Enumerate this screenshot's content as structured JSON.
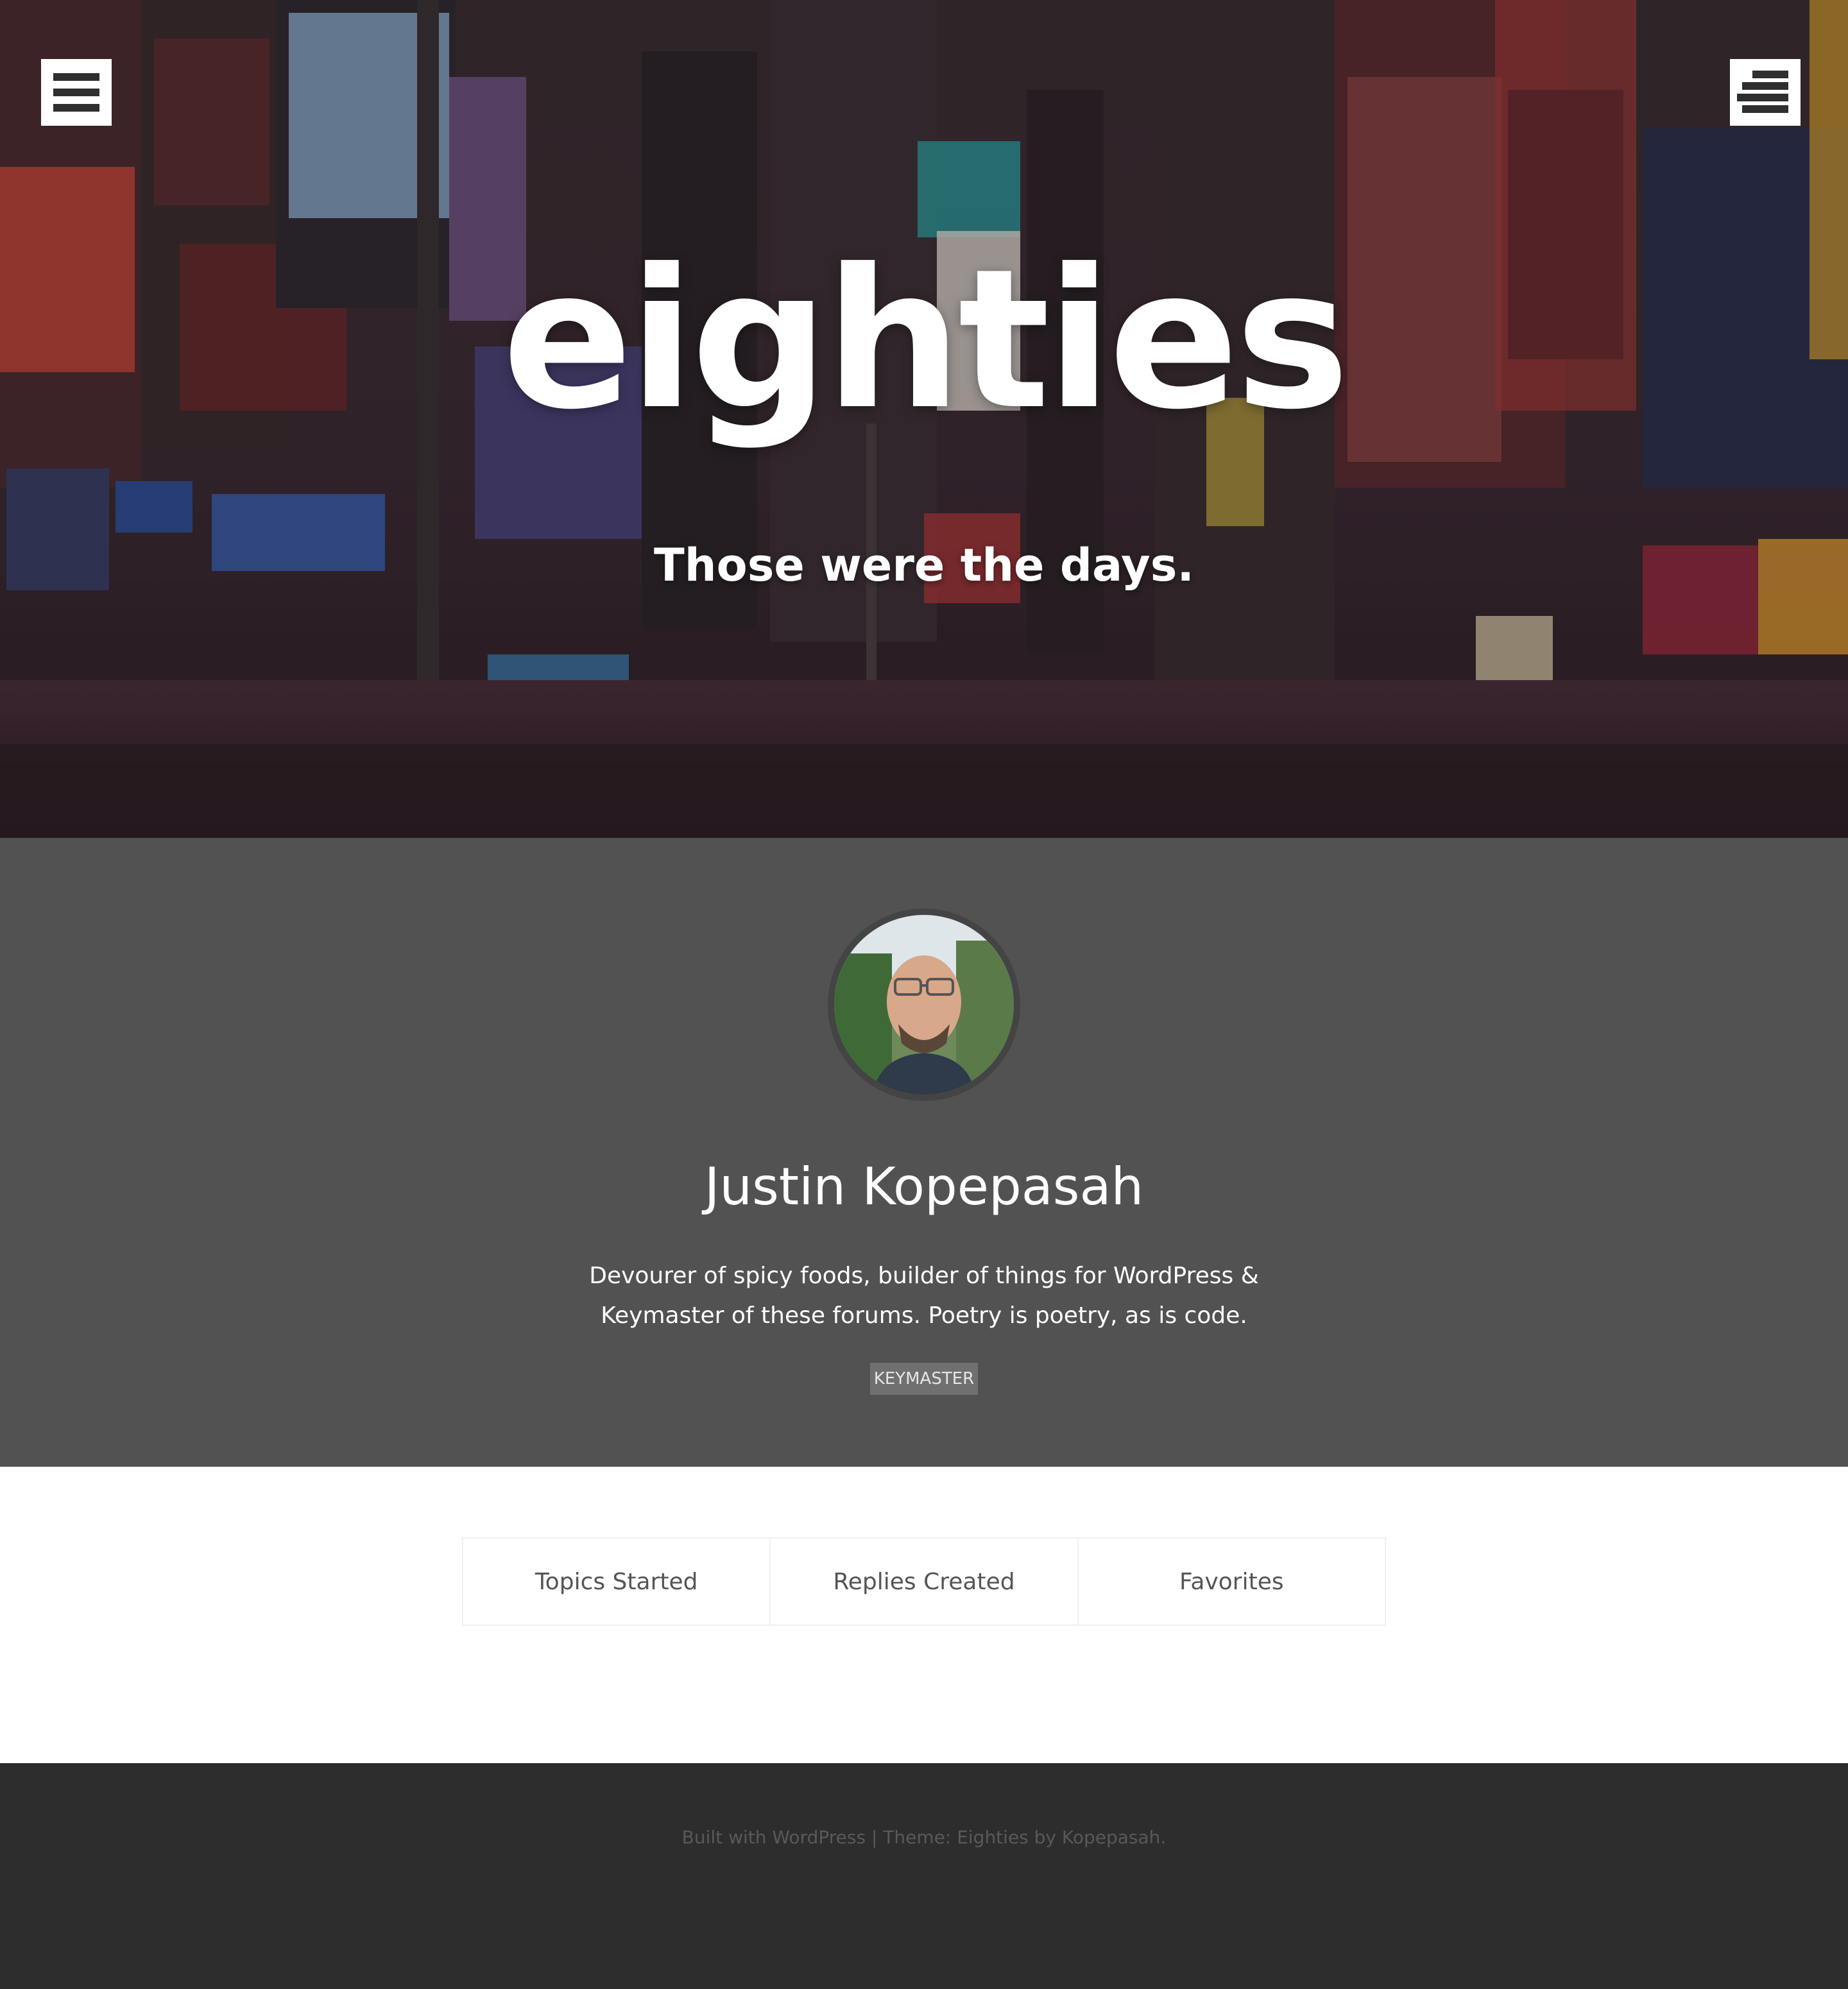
{
  "header": {
    "site_title": "eighties",
    "tagline": "Those were the days.",
    "left_menu_icon": "hamburger-menu-icon",
    "right_menu_icon": "sidebar-menu-icon"
  },
  "profile": {
    "name": "Justin Kopepasah",
    "bio": "Devourer of spicy foods, builder of things for WordPress & Keymaster of these forums. Poetry is poetry, as is code.",
    "role": "KEYMASTER"
  },
  "tabs": [
    {
      "label": "Topics Started"
    },
    {
      "label": "Replies Created"
    },
    {
      "label": "Favorites"
    }
  ],
  "footer": {
    "built_with": "Built with WordPress",
    "separator": "|",
    "theme": "Theme: Eighties by Kopepasah."
  },
  "colors": {
    "profile_bg": "#525252",
    "footer_bg": "#2d2d2d",
    "badge_bg": "#707070"
  }
}
